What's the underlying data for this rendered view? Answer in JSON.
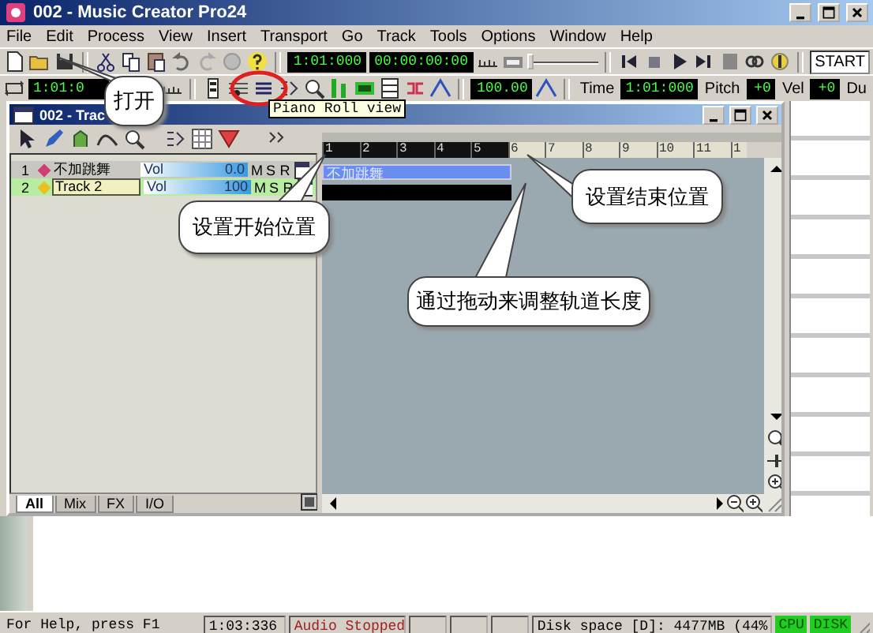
{
  "window": {
    "title": "002 - Music Creator Pro24"
  },
  "menu": [
    "File",
    "Edit",
    "Process",
    "View",
    "Insert",
    "Transport",
    "Go",
    "Track",
    "Tools",
    "Options",
    "Window",
    "Help"
  ],
  "toolbar": {
    "now_time": "1:01:000",
    "smpte": "00:00:00:00",
    "scrub_slider": {
      "level": 0
    },
    "marker_field": "START"
  },
  "toolbar2": {
    "from_time": "1:01:0",
    "tempo": "100.00",
    "time_label": "Time",
    "time_value": "1:01:000",
    "pitch_label": "Pitch",
    "pitch_value": "+0",
    "vel_label": "Vel",
    "vel_value": "+0",
    "dur_label": "Du"
  },
  "track_view": {
    "title": "002 - Trac",
    "tracks": [
      {
        "number": "1",
        "name": "不加跳舞",
        "vol_label": "Vol",
        "vol_value": "0.0",
        "mute": "M",
        "solo": "S",
        "rec": "R",
        "selected": false,
        "color": "#d04070",
        "clip": "不加跳舞",
        "clip_selected": true
      },
      {
        "number": "2",
        "name": "Track 2",
        "vol_label": "Vol",
        "vol_value": "100",
        "mute": "M",
        "solo": "S",
        "rec": "R",
        "selected": true,
        "color": "#e8c020",
        "clip_selected": false
      }
    ],
    "tabs": [
      {
        "label": "All",
        "selected": true
      },
      {
        "label": "Mix",
        "selected": false
      },
      {
        "label": "FX",
        "selected": false
      },
      {
        "label": "I/O",
        "selected": false
      }
    ],
    "ruler": [
      {
        "label": "1",
        "in_selection": true
      },
      {
        "label": "2",
        "in_selection": true
      },
      {
        "label": "3",
        "in_selection": true
      },
      {
        "label": "4",
        "in_selection": true
      },
      {
        "label": "5",
        "in_selection": true
      },
      {
        "label": "6",
        "in_selection": false
      },
      {
        "label": "7",
        "in_selection": false
      },
      {
        "label": "8",
        "in_selection": false
      },
      {
        "label": "9",
        "in_selection": false
      },
      {
        "label": "10",
        "in_selection": false
      },
      {
        "label": "11",
        "in_selection": false
      },
      {
        "label": "1",
        "in_selection": false
      }
    ]
  },
  "tooltip": "Piano Roll view",
  "callouts": [
    "打开",
    "设置开始位置",
    "设置结束位置",
    "通过拖动来调整轨道长度"
  ],
  "status_bar": {
    "help": "For Help, press F1",
    "time": "1:03:336",
    "audio": "Audio Stopped",
    "disk": "Disk space [D]: 4477MB (44%",
    "cpu": "CPU",
    "disk_meter": "DISK"
  }
}
